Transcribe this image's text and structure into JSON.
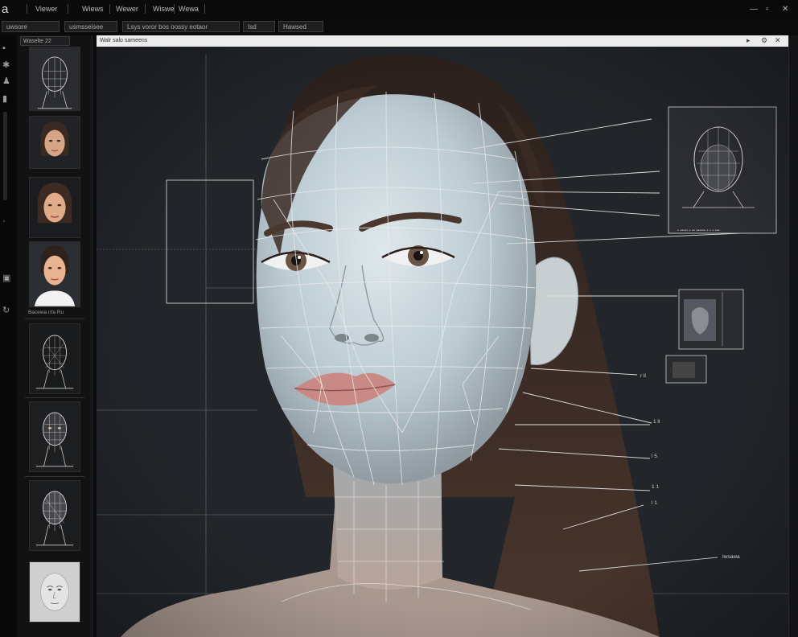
{
  "menubar": {
    "app_icon": "a",
    "items": [
      "Viewer",
      "Wiews",
      "Wewer",
      "Wiswe",
      "Wewa"
    ],
    "window_controls": {
      "minimize": "—",
      "restore": "▫",
      "close": "✕"
    }
  },
  "toolbar": {
    "buttons": [
      "uwsore",
      "usmsseisee",
      "Lsys voror bos oossy eotaor",
      "Isd",
      "Hawsed"
    ]
  },
  "panel": {
    "tab_label": "Waselte 22",
    "caption": "Bacewa nfa Ru"
  },
  "viewport": {
    "title": "Walr salo sameens"
  },
  "annotations": {
    "label_bottom": "Iwsawa",
    "small_marks": [
      "r ll",
      "1 ll",
      "l 5",
      "1 1",
      "l 1"
    ]
  },
  "colors": {
    "background": "#0b0b0c",
    "viewport_bg": "#222529",
    "wireframe": "#e6e6e6",
    "skin_light": "#c9d6dd",
    "hair": "#3a2a24"
  }
}
